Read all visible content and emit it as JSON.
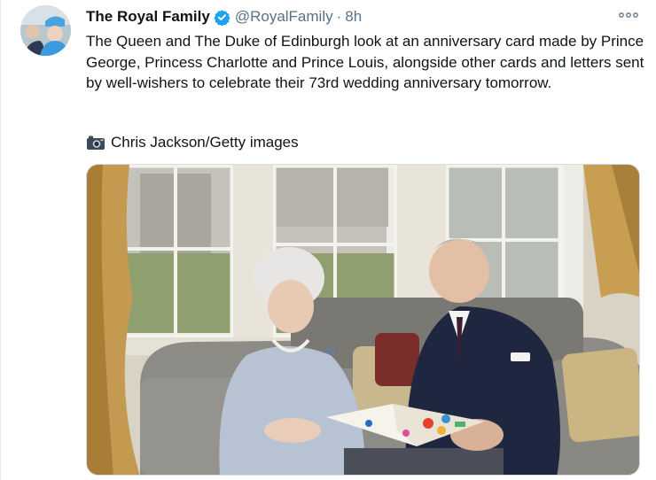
{
  "author": {
    "name": "The Royal Family",
    "handle": "@RoyalFamily",
    "separator": "·",
    "time": "8h"
  },
  "icons": {
    "avatar": "avatar-photo",
    "verified": "verified-badge-icon",
    "more": "more-options-icon",
    "camera": "camera-icon"
  },
  "colors": {
    "verified": "#1da1f2",
    "secondary_text": "#5b7083",
    "primary_text": "#0f1419"
  },
  "tweet": {
    "text": "The Queen and The Duke of Edinburgh look at an anniversary card made by Prince George, Princess Charlotte and Prince Louis, alongside other cards and letters sent by well-wishers to celebrate their 73rd wedding anniversary tomorrow.",
    "credit": "Chris Jackson/Getty images"
  }
}
